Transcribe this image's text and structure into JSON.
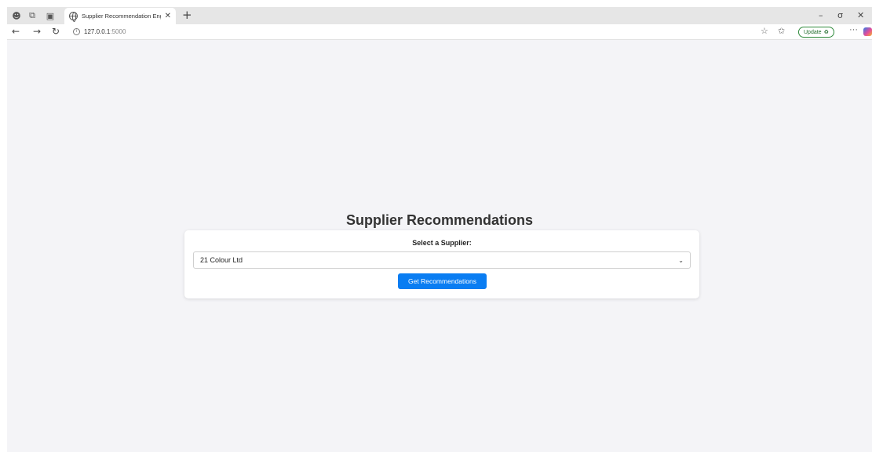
{
  "browser": {
    "tab": {
      "title": "Supplier Recommendation Engine"
    },
    "address": {
      "host": "127.0.0.1",
      "port": ":5000"
    },
    "update_label": "Update"
  },
  "page": {
    "heading": "Supplier Recommendations",
    "form": {
      "select_label": "Select a Supplier:",
      "selected_supplier": "21 Colour Ltd",
      "submit_label": "Get Recommendations"
    }
  },
  "colors": {
    "page_background": "#f4f4f7",
    "button": "#0a7df2",
    "heading": "#333333"
  },
  "icons": [
    "profile-icon",
    "collections-icon",
    "tab-actions-icon",
    "globe-icon",
    "close-icon",
    "new-tab-icon",
    "minimize-icon",
    "restore-icon",
    "window-close-icon",
    "back-icon",
    "forward-icon",
    "refresh-icon",
    "info-icon",
    "favorite-star-icon",
    "favorites-icon",
    "more-icon",
    "copilot-icon",
    "chevron-down-icon"
  ]
}
